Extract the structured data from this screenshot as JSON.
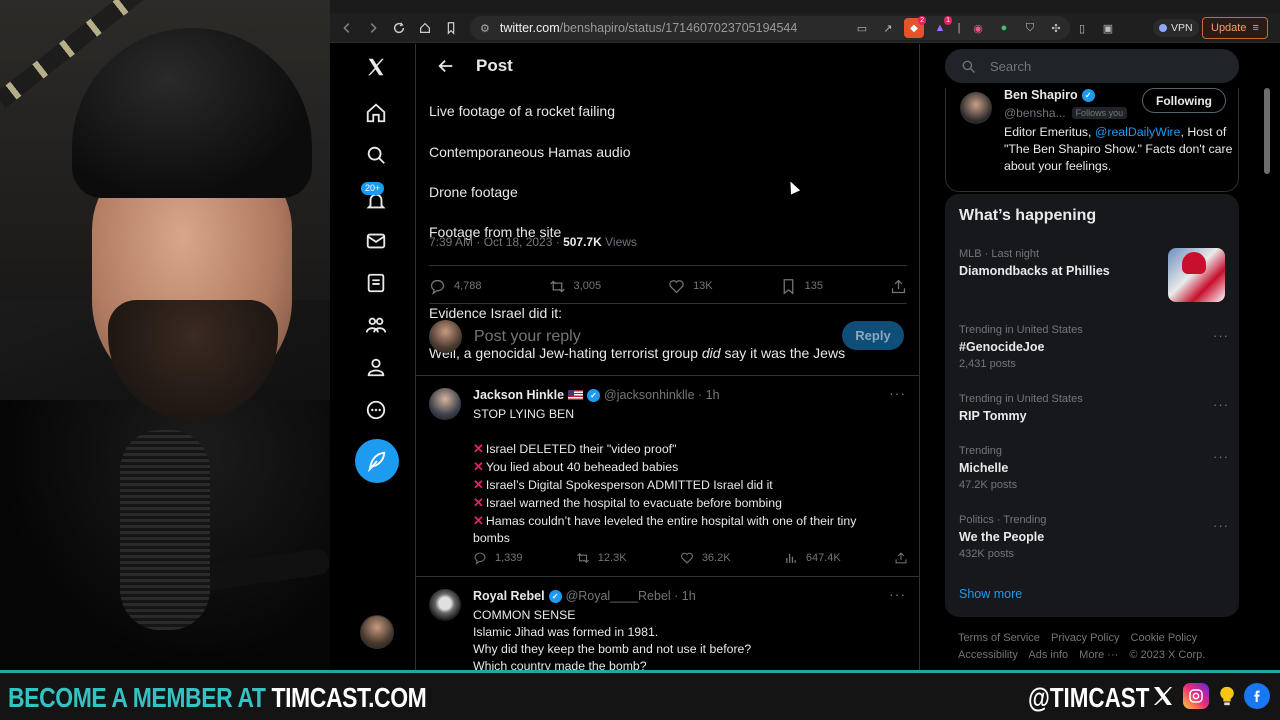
{
  "browser": {
    "url_host": "twitter.com",
    "url_path": "/benshapiro/status/1714607023705194544",
    "vpn_label": "VPN",
    "update_label": "Update",
    "ext_badge_1": "2",
    "ext_badge_2": "1"
  },
  "leftnav": {
    "notifications_badge": "20+"
  },
  "header": {
    "title": "Post"
  },
  "tweet": {
    "lines": [
      "Live footage of a rocket failing",
      "Contemporaneous Hamas audio",
      "Drone footage",
      "Footage from the site",
      "",
      "Evidence Israel did it:"
    ],
    "last_line_pre": "Well, a genocidal Jew-hating terrorist group ",
    "last_line_em": "did",
    "last_line_post": " say it was the Jews",
    "timestamp": "7:39 AM · Oct 18, 2023 · ",
    "views_count": "507.7K",
    "views_label": " Views",
    "replies": "4,788",
    "reposts": "3,005",
    "likes": "13K",
    "bookmarks": "135"
  },
  "reply_box": {
    "placeholder": "Post your reply",
    "button": "Reply"
  },
  "replies": [
    {
      "name": "Jackson Hinkle",
      "handle": "@jacksonhinklle · 1h",
      "lines": [
        "STOP LYING BEN",
        "",
        "Israel DELETED their \"video proof\"",
        "You lied about 40 beheaded babies",
        "Israel’s Digital Spokesperson ADMITTED Israel did it",
        "Israel warned the hospital to evacuate before bombing",
        "Hamas couldn’t have leveled the entire hospital with one of their tiny",
        "bombs"
      ],
      "x_prefixed": [
        false,
        false,
        true,
        true,
        true,
        true,
        true,
        false
      ],
      "replies": "1,339",
      "reposts": "12.3K",
      "likes": "36.2K",
      "views": "647.4K"
    },
    {
      "name": "Royal Rebel",
      "handle": "@Royal____Rebel · 1h",
      "lines": [
        "COMMON SENSE",
        "Islamic Jihad was formed in 1981.",
        "Why did they keep the bomb and not use it before?",
        "Which country made the bomb?"
      ]
    }
  ],
  "right": {
    "search_placeholder": "Search",
    "profile": {
      "name": "Ben Shapiro",
      "handle": "@bensha...",
      "follows_you": "Follows you",
      "following_button": "Following",
      "bio_pre": "Editor Emeritus, ",
      "bio_link": "@realDailyWire",
      "bio_post": ", Host of \"The Ben Shapiro Show.\" Facts don't care about your feelings."
    },
    "trends_title": "What’s happening",
    "trends": [
      {
        "context": "MLB · Last night",
        "topic": "Diamondbacks at Phillies",
        "count": ""
      },
      {
        "context": "Trending in United States",
        "topic": "#GenocideJoe",
        "count": "2,431 posts"
      },
      {
        "context": "Trending in United States",
        "topic": "RIP Tommy",
        "count": ""
      },
      {
        "context": "Trending",
        "topic": "Michelle",
        "count": "47.2K posts"
      },
      {
        "context": "Politics · Trending",
        "topic": "We the People",
        "count": "432K posts"
      }
    ],
    "show_more": "Show more",
    "footer": [
      "Terms of Service",
      "Privacy Policy",
      "Cookie Policy",
      "Accessibility",
      "Ads info",
      "More ···",
      "© 2023 X Corp."
    ]
  },
  "banner": {
    "left_part1": "BECOME A MEMBER AT ",
    "left_part2": "TIMCAST.COM",
    "handle": "@TIMCAST"
  },
  "colors": {
    "accent": "#1d9bf0",
    "banner_teal": "#34c2c2",
    "background": "#000000",
    "muted_text": "#71767b"
  }
}
